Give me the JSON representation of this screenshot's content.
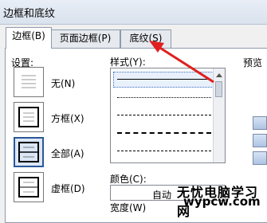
{
  "window": {
    "title": "边框和底纹"
  },
  "tabs": [
    {
      "label": "边框(B)",
      "active": true
    },
    {
      "label": "页面边框(P)",
      "active": false
    },
    {
      "label": "底纹(S)",
      "active": false
    }
  ],
  "settings": {
    "label": "设置:",
    "presets": [
      {
        "label": "无(N)",
        "selected": false
      },
      {
        "label": "方框(X)",
        "selected": false
      },
      {
        "label": "全部(A)",
        "selected": true
      },
      {
        "label": "虚框(D)",
        "selected": false
      }
    ]
  },
  "style": {
    "label": "样式(Y):"
  },
  "color": {
    "label": "颜色(C):",
    "value": "自动"
  },
  "width": {
    "label": "宽度(W)"
  },
  "preview": {
    "label": "预览"
  },
  "watermark": {
    "line1": "无忧电脑学习网",
    "line2": "wypcw.com"
  }
}
